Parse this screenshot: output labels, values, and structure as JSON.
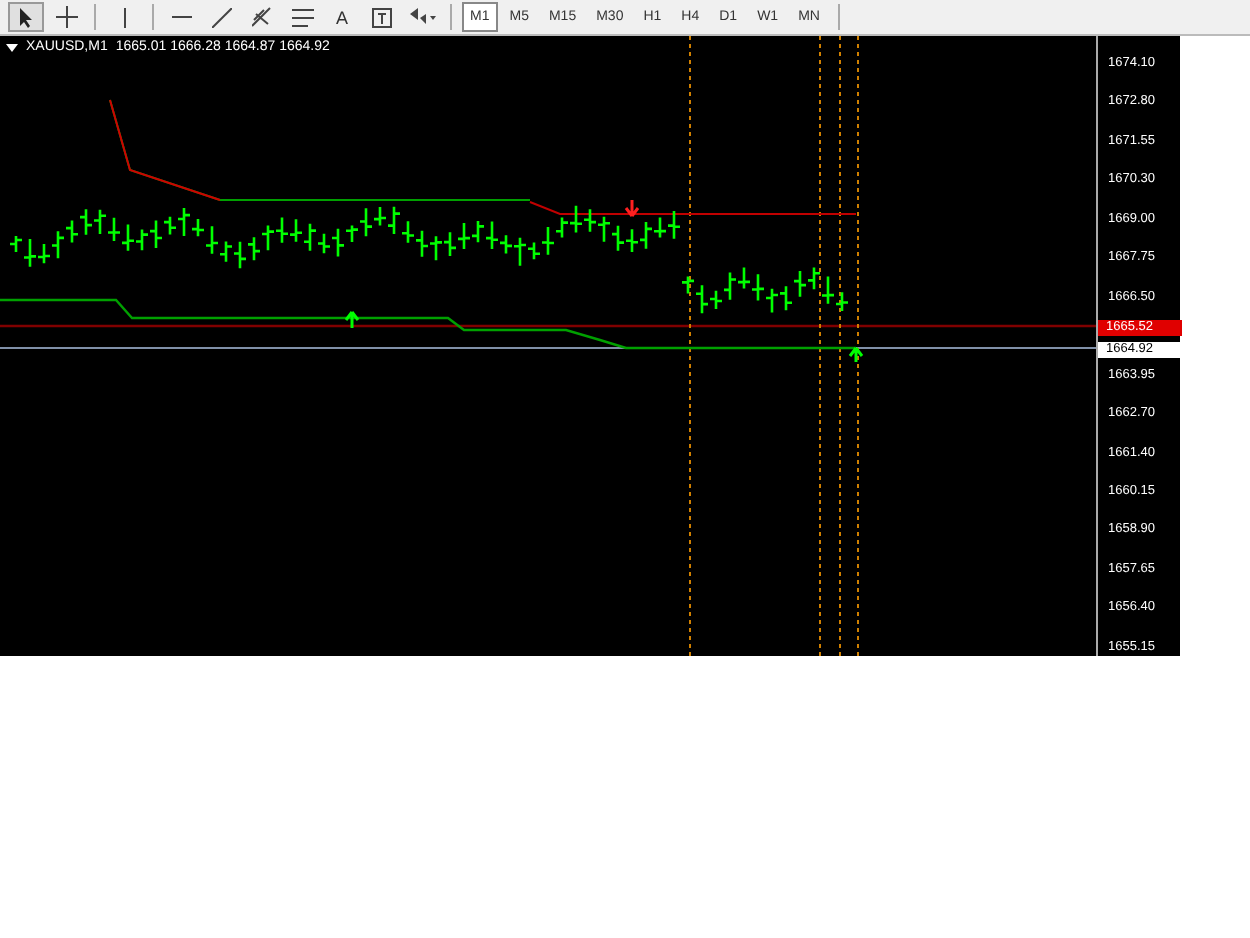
{
  "toolbar": {
    "tools": [
      {
        "kind": "cursor",
        "selected": true
      },
      {
        "kind": "crosshair",
        "selected": false
      },
      {
        "kind": "vline",
        "selected": false
      },
      {
        "kind": "hline",
        "selected": false
      },
      {
        "kind": "trendline",
        "selected": false
      },
      {
        "kind": "fibo",
        "selected": false
      },
      {
        "kind": "channel",
        "selected": false
      },
      {
        "kind": "text",
        "label": "A",
        "selected": false
      },
      {
        "kind": "label",
        "selected": false
      },
      {
        "kind": "arrows",
        "selected": false
      }
    ],
    "periods": [
      {
        "label": "M1",
        "selected": true
      },
      {
        "label": "M5",
        "selected": false
      },
      {
        "label": "M15",
        "selected": false
      },
      {
        "label": "M30",
        "selected": false
      },
      {
        "label": "H1",
        "selected": false
      },
      {
        "label": "H4",
        "selected": false
      },
      {
        "label": "D1",
        "selected": false
      },
      {
        "label": "W1",
        "selected": false
      },
      {
        "label": "MN",
        "selected": false
      }
    ]
  },
  "chart": {
    "symbol": "XAUUSD,M1",
    "quote": "1665.01 1666.28 1664.87 1664.92",
    "price_axis": [
      "1674.10",
      "1672.80",
      "1671.55",
      "1670.30",
      "1669.00",
      "1667.75",
      "1666.50",
      "1663.95",
      "1662.70",
      "1661.40",
      "1660.15",
      "1658.90",
      "1657.65",
      "1656.40",
      "1655.15"
    ],
    "markers": [
      {
        "kind": "ask",
        "label": "1665.52"
      },
      {
        "kind": "bid",
        "label": "1664.92"
      }
    ]
  }
}
